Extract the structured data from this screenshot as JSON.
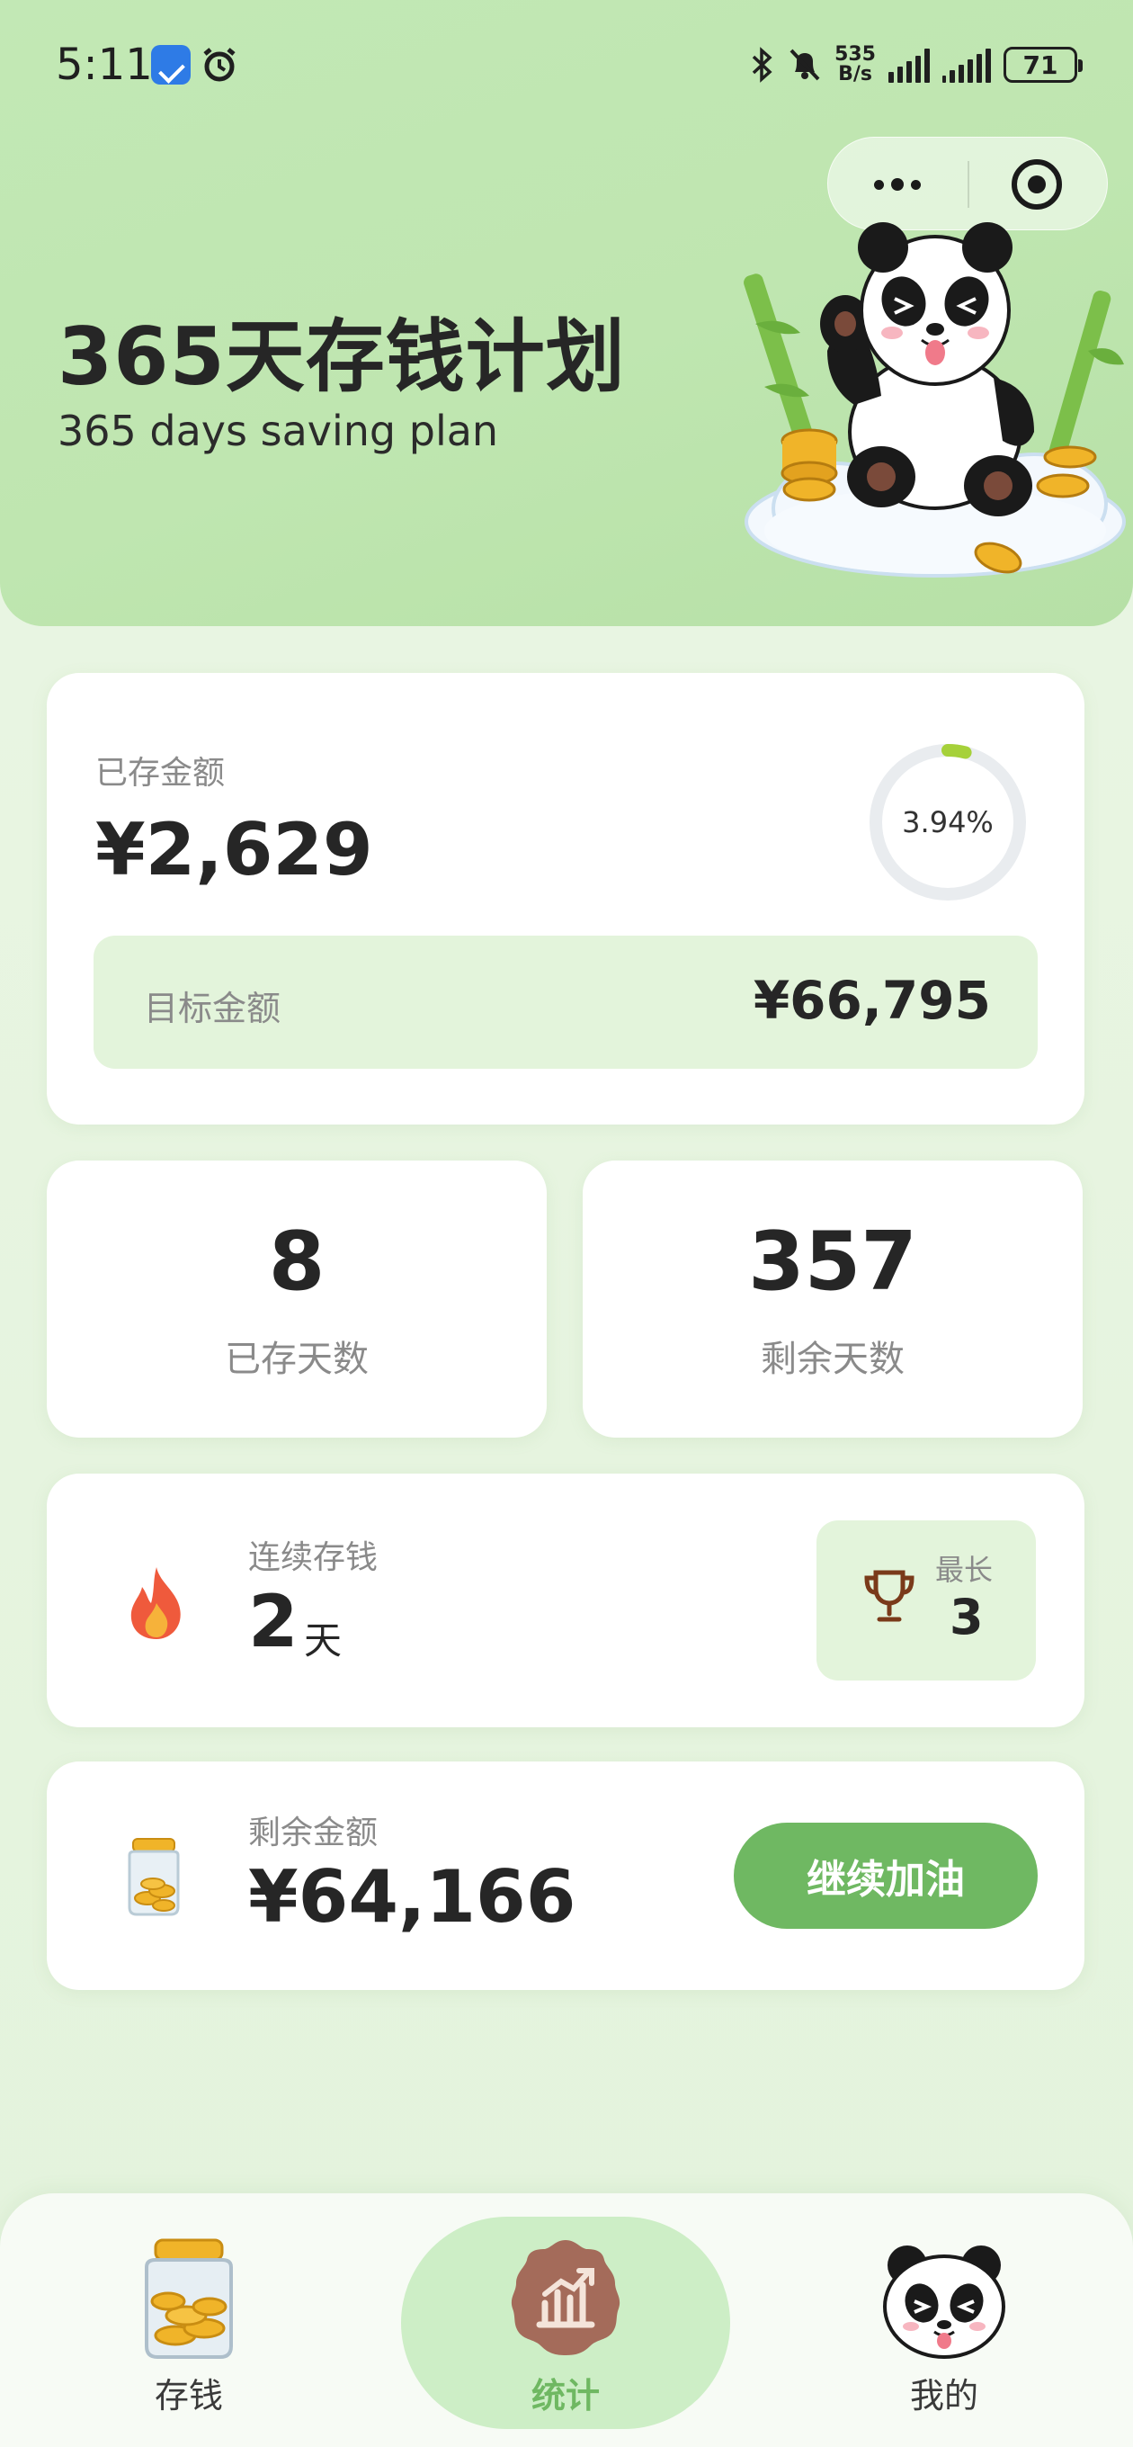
{
  "status_bar": {
    "time": "5:11",
    "net_speed_value": "535",
    "net_speed_unit": "B/s",
    "battery": "71"
  },
  "header": {
    "title": "365天存钱计划",
    "subtitle": "365 days saving plan"
  },
  "saved_card": {
    "label": "已存金额",
    "amount": "¥2,629",
    "progress_text": "3.94%",
    "progress_fraction": 0.0394,
    "target_label": "目标金额",
    "target_amount": "¥66,795"
  },
  "days": {
    "saved_days": "8",
    "saved_days_label": "已存天数",
    "remaining_days": "357",
    "remaining_days_label": "剩余天数"
  },
  "streak": {
    "label": "连续存钱",
    "value": "2",
    "unit": "天",
    "best_label": "最长",
    "best_value": "3"
  },
  "remaining": {
    "label": "剩余金额",
    "amount": "¥64,166",
    "button_label": "继续加油"
  },
  "tabbar": {
    "tabs": [
      {
        "label": "存钱",
        "icon": "coin-jar-icon"
      },
      {
        "label": "统计",
        "icon": "stats-chart-icon",
        "active": true
      },
      {
        "label": "我的",
        "icon": "panda-face-icon"
      }
    ]
  },
  "colors": {
    "accent": "#6fb862",
    "header_bg": "#bfe6b0",
    "soft_green": "#e3f4db",
    "progress": "#a6d13a"
  }
}
